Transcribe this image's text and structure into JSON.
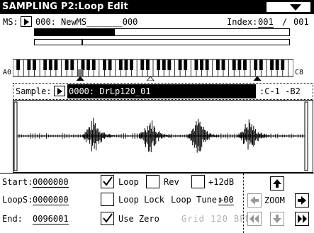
{
  "header": {
    "title": "SAMPLING P2:Loop Edit"
  },
  "ms_row": {
    "label": "MS:",
    "number": "000:",
    "name": "NewMS_______000",
    "index_label": "Index:",
    "index_value": "001",
    "index_sep": "/",
    "index_total": "001"
  },
  "keyboard": {
    "low_label": "A0",
    "high_label": "C8"
  },
  "sample_row": {
    "label": "Sample:",
    "value": "0000: DrLp120_01",
    "range": ":C-1 -B2"
  },
  "waveform": {
    "bursts": [
      0.27,
      0.46,
      0.62,
      0.79
    ]
  },
  "params": {
    "start_label": "Start:",
    "start_value": "0000000",
    "loops_label": "LoopS:",
    "loops_value": "0000000",
    "end_label": "End:",
    "end_value": "0096001",
    "loop_label": "Loop",
    "loop_checked": true,
    "rev_label": "Rev",
    "rev_checked": false,
    "plus12_label": "+12dB",
    "plus12_checked": false,
    "looplock_label": "Loop Lock",
    "looplock_checked": false,
    "looptune_label": "Loop Tune:",
    "looptune_value": "+00",
    "usezero_label": "Use Zero",
    "usezero_checked": true,
    "bpm_label": "Grid 120 BPM"
  },
  "zoom": {
    "label": "ZOOM"
  }
}
